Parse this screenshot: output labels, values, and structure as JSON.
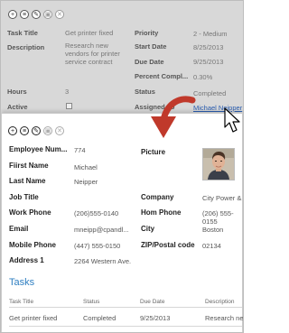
{
  "task_form": {
    "toolbar": [
      {
        "glyph": "+",
        "icon": "add-icon"
      },
      {
        "glyph": "≡",
        "icon": "delete-icon"
      },
      {
        "glyph": "✎",
        "icon": "edit-icon"
      },
      {
        "glyph": "▣",
        "icon": "save-icon"
      },
      {
        "glyph": "✕",
        "icon": "cancel-icon"
      }
    ],
    "left_fields": {
      "task_title_label": "Task Title",
      "task_title_value": "Get printer fixed",
      "description_label": "Description",
      "description_lines": [
        "Research new",
        "vendors for printer",
        "service contract"
      ],
      "hours_label": "Hours",
      "hours_value": "3",
      "active_label": "Active"
    },
    "right_fields": {
      "priority_label": "Priority",
      "priority_value": "2 - Medium",
      "start_date_label": "Start Date",
      "start_date_value": "8/25/2013",
      "due_date_label": "Due Date",
      "due_date_value": "9/25/2013",
      "percent_label": "Percent Compl...",
      "percent_value": "0.30%",
      "status_label": "Status",
      "status_value": "Completed",
      "assigned_label": "Assigned To",
      "assigned_value": "Michael Neipper"
    }
  },
  "employee_form": {
    "toolbar": [
      {
        "glyph": "+",
        "icon": "add-icon"
      },
      {
        "glyph": "≡",
        "icon": "delete-icon"
      },
      {
        "glyph": "✎",
        "icon": "edit-icon"
      },
      {
        "glyph": "▣",
        "icon": "save-icon"
      },
      {
        "glyph": "✕",
        "icon": "cancel-icon"
      }
    ],
    "fields": {
      "employee_number_label": "Employee Num...",
      "employee_number_value": "774",
      "first_name_label": "Fiirst Name",
      "first_name_value": "Michael",
      "last_name_label": "Last Name",
      "last_name_value": "Neipper",
      "job_title_label": "Job Title",
      "work_phone_label": "Work Phone",
      "work_phone_value": "(206)555-0140",
      "email_label": "Email",
      "email_value": "mneipp@cpandl...",
      "mobile_phone_label": "Mobile Phone",
      "mobile_phone_value": "(447) 555-0150",
      "address_label": "Address 1",
      "address_value": "2264 Western Ave.",
      "picture_label": "Picture",
      "company_label": "Company",
      "company_value": "City Power &",
      "home_phone_label": "Hom Phone",
      "home_phone_value": "(206) 555-0155",
      "city_label": "City",
      "city_value": "Boston",
      "zip_label": "ZIP/Postal code",
      "zip_value": "02134"
    },
    "tasks": {
      "title": "Tasks",
      "headers": [
        "Task Title",
        "Status",
        "Due Date",
        "Description"
      ],
      "rows": [
        [
          "Get printer fixed",
          "Completed",
          "9/25/2013",
          "Research new"
        ]
      ]
    }
  },
  "colors": {
    "arrow": "#c0392b",
    "link": "#2a5db0",
    "tasks_heading": "#2f7fc1"
  }
}
